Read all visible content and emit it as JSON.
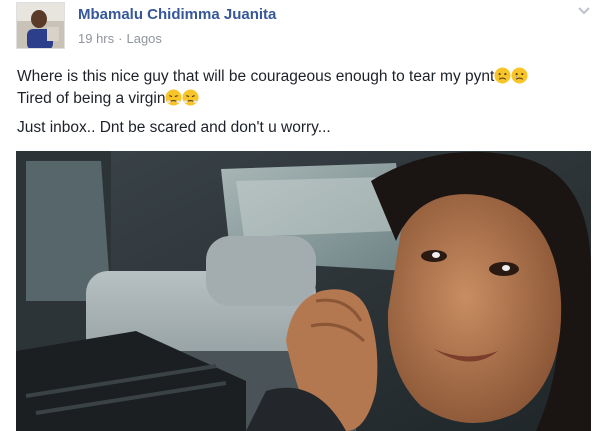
{
  "post": {
    "author": "Mbamalu Chidimma Juanita",
    "time": "19 hrs",
    "separator": "·",
    "location": "Lagos",
    "line1": "Where is this nice guy that will be courageous enough to tear my pynt",
    "line1_emojis": [
      "crying-face",
      "crying-face"
    ],
    "line2": "Tired of being a virgin",
    "line2_emojis": [
      "steam-from-nose-face",
      "steam-from-nose-face"
    ],
    "line3": "Just inbox.. Dnt be scared and don't u worry..."
  },
  "colors": {
    "author_link": "#365899",
    "meta": "#90949c",
    "text": "#1d2129",
    "emoji_yellow": "#f7c52a"
  },
  "icons": {
    "menu": "chevron-down-icon",
    "globe": "none"
  }
}
